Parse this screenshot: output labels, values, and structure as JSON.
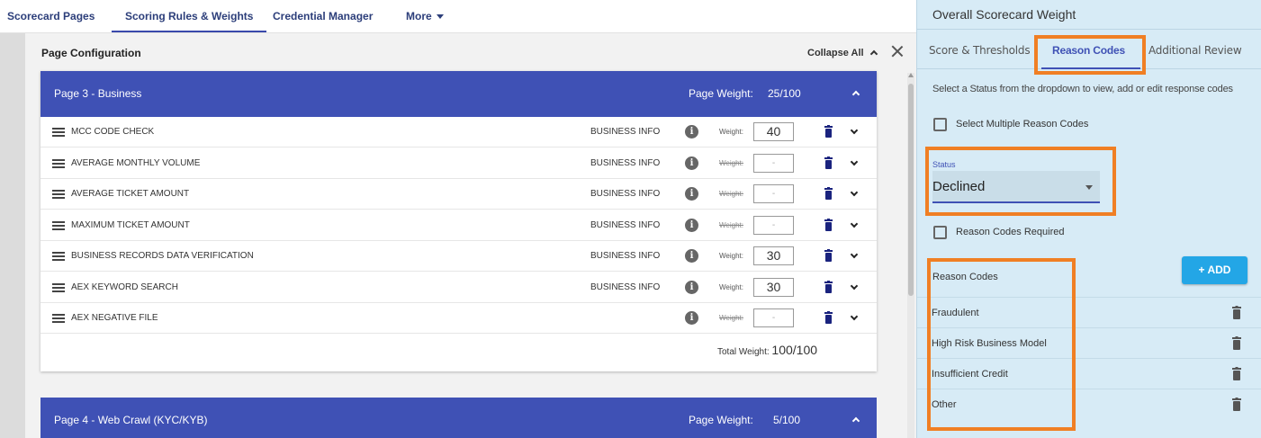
{
  "nav": {
    "tabs": [
      {
        "label": "Scorecard Pages"
      },
      {
        "label": "Scoring Rules & Weights"
      },
      {
        "label": "Credential Manager"
      },
      {
        "label": "More"
      }
    ]
  },
  "config": {
    "title": "Page Configuration",
    "collapse_all": "Collapse All"
  },
  "page3": {
    "title": "Page 3 - Business",
    "weight_label": "Page Weight:",
    "weight_value": "25/100",
    "rows": [
      {
        "name": "MCC CODE CHECK",
        "category": "BUSINESS INFO",
        "weight_label": "Weight:",
        "weight": "40"
      },
      {
        "name": "AVERAGE MONTHLY VOLUME",
        "category": "BUSINESS INFO",
        "weight_label": "Weight:",
        "weight": "-"
      },
      {
        "name": "AVERAGE TICKET AMOUNT",
        "category": "BUSINESS INFO",
        "weight_label": "Weight:",
        "weight": "-"
      },
      {
        "name": "MAXIMUM TICKET AMOUNT",
        "category": "BUSINESS INFO",
        "weight_label": "Weight:",
        "weight": "-"
      },
      {
        "name": "BUSINESS RECORDS DATA VERIFICATION",
        "category": "BUSINESS INFO",
        "weight_label": "Weight:",
        "weight": "30"
      },
      {
        "name": "AEX KEYWORD SEARCH",
        "category": "BUSINESS INFO",
        "weight_label": "Weight:",
        "weight": "30"
      },
      {
        "name": "AEX NEGATIVE FILE",
        "category": "",
        "weight_label": "Weight:",
        "weight": "-"
      }
    ],
    "total_label": "Total Weight:",
    "total_value": "100/100"
  },
  "page4": {
    "title": "Page 4 - Web Crawl (KYC/KYB)",
    "weight_label": "Page Weight:",
    "weight_value": "5/100"
  },
  "panel": {
    "title": "Overall Scorecard Weight",
    "tabs": [
      {
        "label": "Score & Thresholds"
      },
      {
        "label": "Reason Codes"
      },
      {
        "label": "Additional Review"
      }
    ],
    "hint": "Select a Status from the dropdown to view, add or edit response codes",
    "select_multiple": "Select Multiple Reason Codes",
    "status_label": "Status",
    "status_value": "Declined",
    "reason_required": "Reason Codes Required",
    "add_label": "+  ADD",
    "reason_header": "Reason Codes",
    "reason_codes": [
      {
        "label": "Fraudulent"
      },
      {
        "label": "High Risk Business Model"
      },
      {
        "label": "Insufficient Credit"
      },
      {
        "label": "Other"
      }
    ]
  },
  "colors": {
    "header_blue": "#3f51b5",
    "highlight_orange": "#f07f24",
    "panel_bg": "#d7ebf6",
    "add_button": "#23a6e6"
  },
  "icons": [
    "drag-handle-icon",
    "info-icon",
    "trash-icon",
    "chevron-down-icon",
    "chevron-up-icon",
    "close-icon",
    "caret-down-icon"
  ]
}
